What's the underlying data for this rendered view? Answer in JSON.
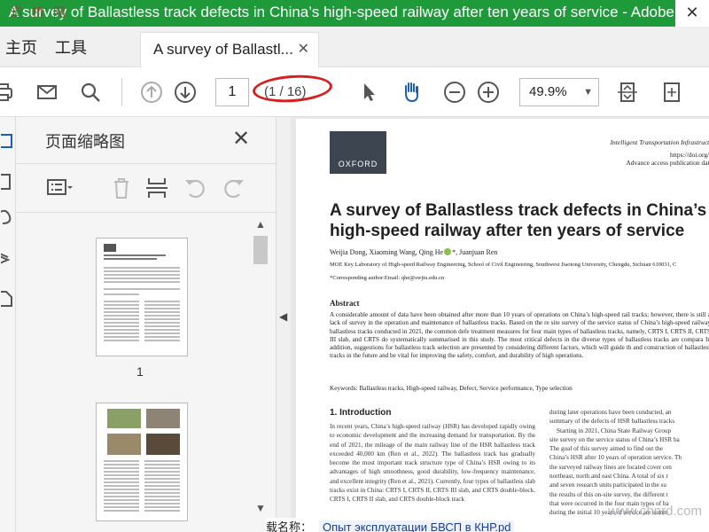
{
  "window": {
    "title": "A survey of Ballastless track defects in China’s high-speed railway after ten years of service - Adobe",
    "close_label": "✕",
    "watermark": "道 桥 网"
  },
  "nav": {
    "home_label": "主页",
    "tools_label": "工具"
  },
  "tab": {
    "label": "A survey of Ballastl...",
    "close": "✕"
  },
  "toolbar": {
    "page_current": "1",
    "page_total": "(1 / 16)",
    "zoom": "49.9%"
  },
  "thumbnails_panel": {
    "title": "页面缩略图",
    "close": "✕",
    "page_label": "1"
  },
  "document": {
    "logo": "OXFORD",
    "journal": "Intelligent Transportation Infrastructu",
    "doi": "https://doi.org/1",
    "advance": "Advance access publication date",
    "title": "A survey of Ballastless track defects in China’s high-speed railway after ten years of service",
    "authors_a": "Weijia Dong, Xiaoming Wang, Qing He",
    "authors_b": "*, Juanjuan Ren",
    "affiliation": "MOE Key Laboratory of High-speed Railway Engineering, School of Civil Engineering, Southwest Jiaotong University, Chengdu, Sichuan 610031, C",
    "corresponding": "*Corresponding author:Email: qhe@swjtu.edu.cn",
    "abstract_heading": "Abstract",
    "abstract": "A considerable amount of data have been obtained after more than 10 years of operations on China’s high-speed rail tracks; however, there is still a lack of survey in the operation and maintenance of ballastless tracks. Based on the re site survey of the service status of China’s high-speed railway ballastless tracks conducted in 2021, the common defe treatment measures for four main types of ballastless tracks, namely, CRTS I, CRTS II, CRTS III slab, and CRTS do systematically summarised in this study. The most critical defects in the diverse types of ballastless tracks are compara In addition, suggestions for ballastless track selection are presented by considering different factors, which will guide th and construction of ballastless tracks in the future and be vital for improving the safety, comfort, and durability of high operations.",
    "keywords": "Keywords: Ballastless tracks, High-speed railway, Defect, Service performance, Type selection",
    "intro_heading": "1.   Introduction",
    "intro_col1": "In recent years, China’s high-speed railway (HSR) has developed rapidly owing to economic development and the increasing demand for transportation. By the end of 2021, the mileage of the main railway line of the HSR ballastless track exceeded 40,000 km (Ren et al., 2022). The ballastless track has gradually become the most important track structure type of China’s HSR owing to its advantages of high smoothness, good durability, low-frequency maintenance, and excellent integrity (Ren et al., 2021). Currently, four types of ballastless slab tracks exist in China: CRTS I, CRTS II, CRTS III slab, and CRTS double-block. CRTS I, CRTS II slab, and CRTS double-block track",
    "intro_col2": [
      "during later operations have been conducted, an",
      "summary of the defects of HSR ballastless tracks",
      "Starting in 2021, China State Railway Group",
      "site survey on the service status of China’s HSR ba",
      "The goal of this survey aimed to find out the",
      "China’s HSR after 10 years of operation service. Th",
      "the surveyed railway lines are located cover cen",
      "northeast, north and east China. A total of six r",
      "and seven research units participated in the su",
      "the results of this on-site survey, the different t",
      "that were occurred in the four main types of ba",
      "during the initial 10 years of service are summ"
    ]
  },
  "bottom": {
    "label": "载名称：",
    "highlight": "Опыт эксплуатации БВСП в КНР.pd"
  },
  "corner_watermark": "www.chnrd.com"
}
